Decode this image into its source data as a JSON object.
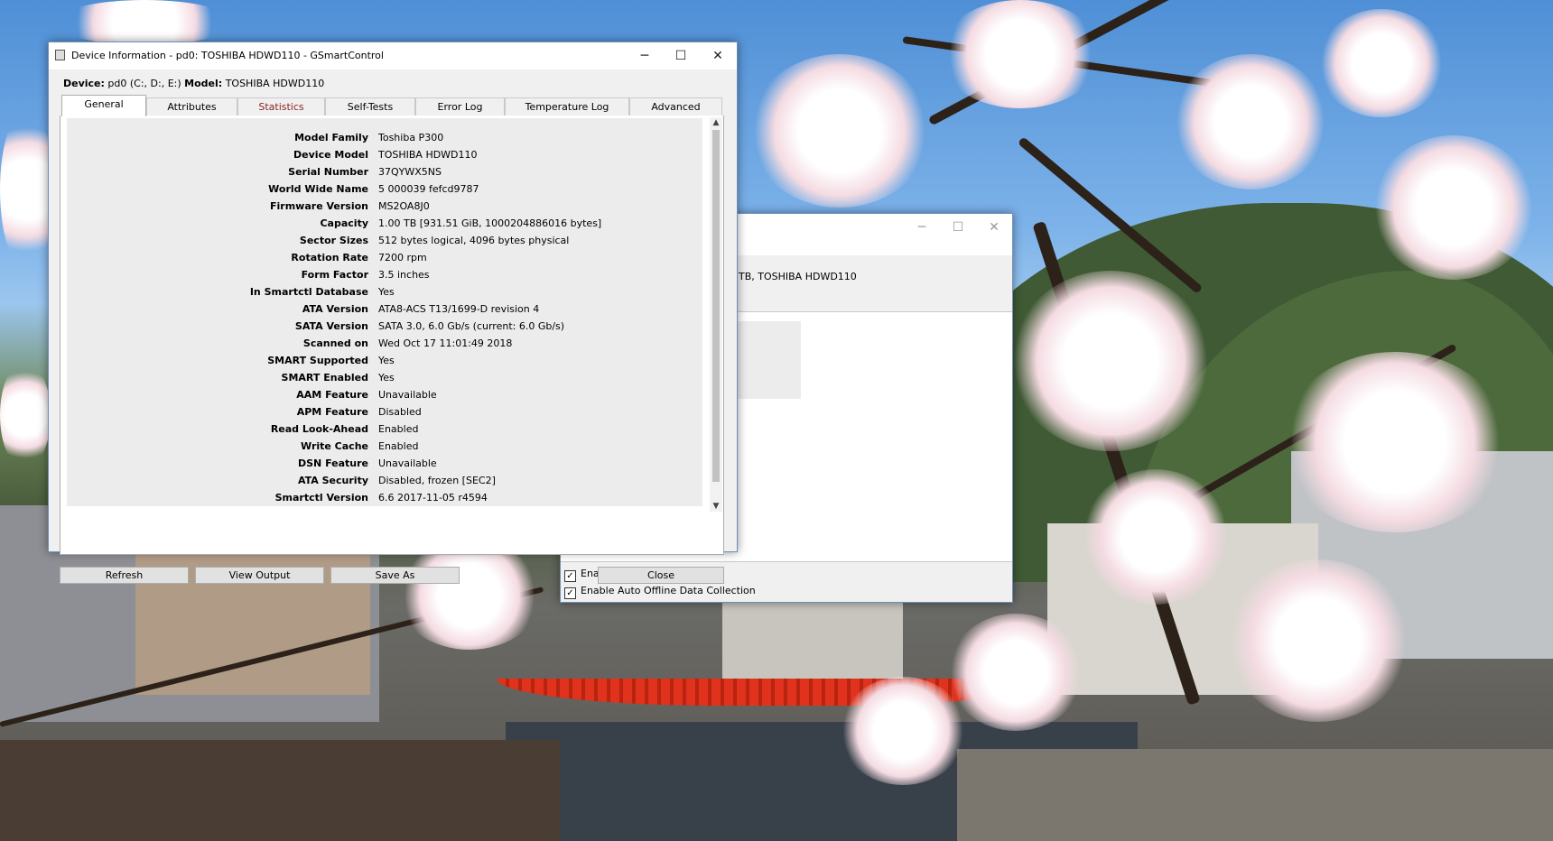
{
  "front_window": {
    "title": "Device Information - pd0: TOSHIBA HDWD110 - GSmartControl",
    "device_label": "Device:",
    "device_value": "pd0 (C:, D:, E:)",
    "model_label": "Model:",
    "model_value": "TOSHIBA HDWD110",
    "tabs": [
      {
        "label": "General"
      },
      {
        "label": "Attributes"
      },
      {
        "label": "Statistics"
      },
      {
        "label": "Self-Tests"
      },
      {
        "label": "Error Log"
      },
      {
        "label": "Temperature Log"
      },
      {
        "label": "Advanced"
      }
    ],
    "info": [
      {
        "key": "Model Family",
        "value": "Toshiba P300"
      },
      {
        "key": "Device Model",
        "value": "TOSHIBA HDWD110"
      },
      {
        "key": "Serial Number",
        "value": "37QYWX5NS"
      },
      {
        "key": "World Wide Name",
        "value": "5 000039 fefcd9787"
      },
      {
        "key": "Firmware Version",
        "value": "MS2OA8J0"
      },
      {
        "key": "Capacity",
        "value": "1.00 TB [931.51 GiB, 1000204886016 bytes]"
      },
      {
        "key": "Sector Sizes",
        "value": "512 bytes logical, 4096 bytes physical"
      },
      {
        "key": "Rotation Rate",
        "value": "7200 rpm"
      },
      {
        "key": "Form Factor",
        "value": "3.5 inches"
      },
      {
        "key": "In Smartctl Database",
        "value": "Yes"
      },
      {
        "key": "ATA Version",
        "value": "ATA8-ACS T13/1699-D revision 4"
      },
      {
        "key": "SATA Version",
        "value": "SATA 3.0, 6.0 Gb/s (current: 6.0 Gb/s)"
      },
      {
        "key": "Scanned on",
        "value": "Wed Oct 17 11:01:49 2018"
      },
      {
        "key": "SMART Supported",
        "value": "Yes"
      },
      {
        "key": "SMART Enabled",
        "value": "Yes"
      },
      {
        "key": "AAM Feature",
        "value": "Unavailable"
      },
      {
        "key": "APM Feature",
        "value": "Disabled"
      },
      {
        "key": "Read Look-Ahead",
        "value": "Enabled"
      },
      {
        "key": "Write Cache",
        "value": "Enabled"
      },
      {
        "key": "DSN Feature",
        "value": "Unavailable"
      },
      {
        "key": "ATA Security",
        "value": "Disabled, frozen [SEC2]"
      },
      {
        "key": "Smartctl Version",
        "value": "6.6 2017-11-05 r4594"
      }
    ],
    "buttons": {
      "refresh": "Refresh",
      "view_output": "View Output",
      "save_as": "Save As",
      "close": "Close"
    }
  },
  "back_window": {
    "header_text": "TB, TOSHIBA HDWD110",
    "options": [
      {
        "label": "Enable SMART",
        "checked": true
      },
      {
        "label": "Enable Auto Offline Data Collection",
        "checked": true
      }
    ]
  },
  "icons": {
    "minimize": "─",
    "maximize": "☐",
    "close": "✕",
    "scroll_up": "▲",
    "scroll_down": "▼",
    "check": "✓"
  },
  "colors": {
    "window_border": "#6c8fb8",
    "statistics_tab_text": "#8b1f1f"
  }
}
